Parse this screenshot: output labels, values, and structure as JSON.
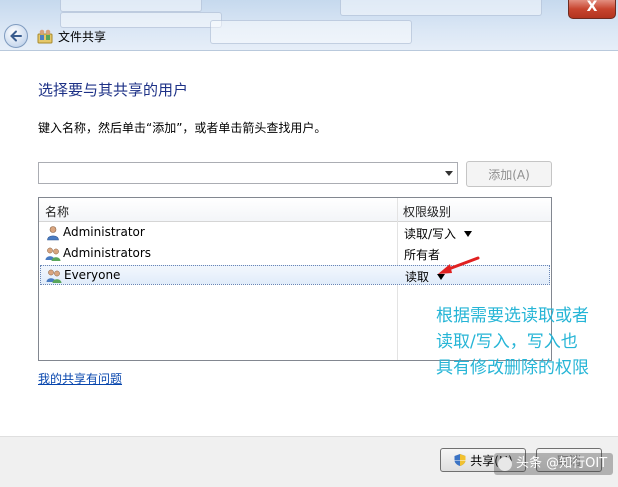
{
  "window": {
    "title": "文件共享",
    "close_label": "X"
  },
  "main": {
    "heading": "选择要与其共享的用户",
    "instruction": "键入名称，然后单击“添加”，或者单击箭头查找用户。",
    "name_input_value": "",
    "add_button": "添加(A)",
    "columns": {
      "name": "名称",
      "permission": "权限级别"
    },
    "rows": [
      {
        "name": "Administrator",
        "permission": "读取/写入",
        "icon": "user-icon"
      },
      {
        "name": "Administrators",
        "permission": "所有者",
        "icon": "group-icon"
      },
      {
        "name": "Everyone",
        "permission": "读取",
        "icon": "group-icon"
      }
    ],
    "help_link": "我的共享有问题"
  },
  "annotation": {
    "lines": [
      "根据需要选读取或者",
      "读取/写入，写入也",
      "具有修改删除的权限"
    ],
    "color": "#26b5d6",
    "arrow_color": "#e02020"
  },
  "footer": {
    "share_button": "共享(H)",
    "cancel_button": "取消"
  },
  "watermark": {
    "text": "头条 @知行OIT"
  }
}
